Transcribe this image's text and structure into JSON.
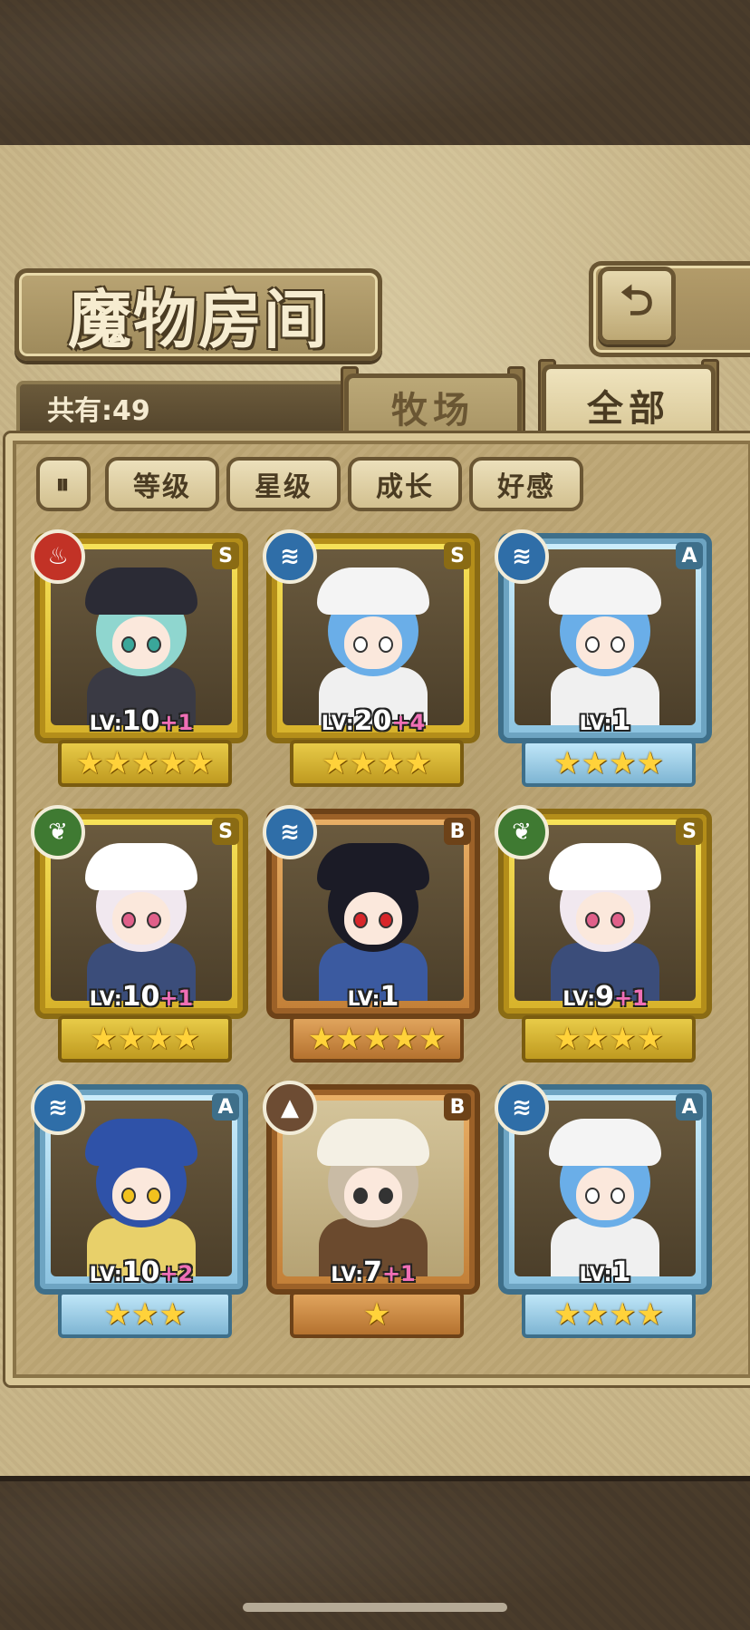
{
  "title": "魔物房间",
  "back_icon": "⮌",
  "count_text": "共有:49",
  "tabs": {
    "pasture": "牧场",
    "all": "全部"
  },
  "sort_icon": "⏸",
  "filters": [
    "等级",
    "星级",
    "成长",
    "好感"
  ],
  "cards": [
    {
      "element": "fire",
      "element_icon": "♨",
      "rank": "S",
      "frame": "gold",
      "level": "10",
      "plus": "+1",
      "stars": "★★★★★",
      "hair": "#8fd6cf",
      "eyes": "#3aa79a",
      "hat": "#2b2b35",
      "body": "#3a3a44"
    },
    {
      "element": "water",
      "element_icon": "≋",
      "rank": "S",
      "frame": "gold",
      "level": "20",
      "plus": "+4",
      "stars": "★★★★",
      "hair": "#6aaee8",
      "eyes": "#ffffff",
      "hat": "#f4f4f4",
      "body": "#f0f0f0"
    },
    {
      "element": "water",
      "element_icon": "≋",
      "rank": "A",
      "frame": "blue",
      "level": "1",
      "plus": "",
      "stars": "★★★★",
      "hair": "#6aaee8",
      "eyes": "#ffffff",
      "hat": "#f4f4f4",
      "body": "#f0f0f0"
    },
    {
      "element": "leaf",
      "element_icon": "❦",
      "rank": "S",
      "frame": "gold",
      "level": "10",
      "plus": "+1",
      "stars": "★★★★",
      "hair": "#f1e8ef",
      "eyes": "#e0608a",
      "hat": "#ffffff",
      "body": "#3b4d7a"
    },
    {
      "element": "water",
      "element_icon": "≋",
      "rank": "B",
      "frame": "bronze",
      "level": "1",
      "plus": "",
      "stars": "★★★★★",
      "hair": "#1b1b26",
      "eyes": "#d8262a",
      "hat": "#1b1b26",
      "body": "#3b5aa0"
    },
    {
      "element": "leaf",
      "element_icon": "❦",
      "rank": "S",
      "frame": "gold",
      "level": "9",
      "plus": "+1",
      "stars": "★★★★",
      "hair": "#f1e8ef",
      "eyes": "#e0608a",
      "hat": "#ffffff",
      "body": "#3b4d7a"
    },
    {
      "element": "water",
      "element_icon": "≋",
      "rank": "A",
      "frame": "blue",
      "level": "10",
      "plus": "+2",
      "stars": "★★★",
      "hair": "#2f52a8",
      "eyes": "#f2c21e",
      "hat": "#2f52a8",
      "body": "#e8d06a"
    },
    {
      "element": "earth",
      "element_icon": "▲",
      "rank": "B",
      "frame": "bronze",
      "level": "7",
      "plus": "+1",
      "stars": "★",
      "hair": "#c9bba5",
      "eyes": "#333333",
      "hat": "#f4f0e4",
      "body": "#6b4a2e"
    },
    {
      "element": "water",
      "element_icon": "≋",
      "rank": "A",
      "frame": "blue",
      "level": "1",
      "plus": "",
      "stars": "★★★★",
      "hair": "#6aaee8",
      "eyes": "#ffffff",
      "hat": "#f4f4f4",
      "body": "#f0f0f0"
    }
  ],
  "level_prefix": "LV:"
}
